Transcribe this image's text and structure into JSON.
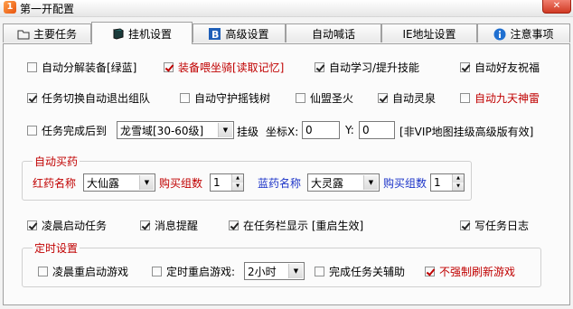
{
  "window": {
    "title": "第一开配置",
    "icon_label": "1",
    "close_icon": "close-icon"
  },
  "tabs": [
    {
      "label": "主要任务",
      "icon": "folder-icon"
    },
    {
      "label": "挂机设置",
      "icon": "book-icon"
    },
    {
      "label": "高级设置",
      "icon": "b-icon"
    },
    {
      "label": "自动喊话",
      "icon": ""
    },
    {
      "label": "IE地址设置",
      "icon": ""
    },
    {
      "label": "注意事项",
      "icon": "info-icon"
    }
  ],
  "row1": [
    {
      "label": "自动分解装备[绿蓝]",
      "checked": false,
      "red": false
    },
    {
      "label": "装备喂坐骑[读取记忆]",
      "checked": true,
      "red": true
    },
    {
      "label": "自动学习/提升技能",
      "checked": true,
      "red": false
    },
    {
      "label": "自动好友祝福",
      "checked": true,
      "red": false
    }
  ],
  "row2": [
    {
      "label": "任务切换自动退出组队",
      "checked": true,
      "red": false
    },
    {
      "label": "自动守护摇钱树",
      "checked": false,
      "red": false
    },
    {
      "label": "仙盟圣火",
      "checked": false,
      "red": false
    },
    {
      "label": "自动灵泉",
      "checked": true,
      "red": false
    },
    {
      "label": "自动九天神雷",
      "checked": false,
      "red": true
    }
  ],
  "row3": {
    "label": "任务完成后到",
    "checked": false,
    "map_select": "龙雪域[30-60级]",
    "hang_label": "挂级",
    "coord_label": "坐标X:",
    "x_value": "0",
    "y_label": "Y:",
    "y_value": "0",
    "note": "[非VIP地图挂级高级版有效]"
  },
  "buy": {
    "legend": "自动买药",
    "red_name_label": "红药名称",
    "red_name_value": "大仙露",
    "red_qty_label": "购买组数",
    "red_qty_value": "1",
    "blue_name_label": "蓝药名称",
    "blue_name_value": "大灵露",
    "blue_qty_label": "购买组数",
    "blue_qty_value": "1"
  },
  "row4": [
    {
      "label": "凌晨启动任务",
      "checked": true
    },
    {
      "label": "消息提醒",
      "checked": true
    },
    {
      "label": "在任务栏显示 [重启生效]",
      "checked": true
    },
    {
      "label": "写任务日志",
      "checked": true
    }
  ],
  "timer": {
    "legend": "定时设置",
    "items": [
      {
        "label": "凌晨重启动游戏",
        "checked": false
      },
      {
        "label": "定时重启游戏:",
        "checked": false
      },
      {
        "label": "完成任务关辅助",
        "checked": false
      },
      {
        "label": "不强制刷新游戏",
        "checked": true,
        "red": true
      }
    ],
    "restart_select": "2小时"
  }
}
